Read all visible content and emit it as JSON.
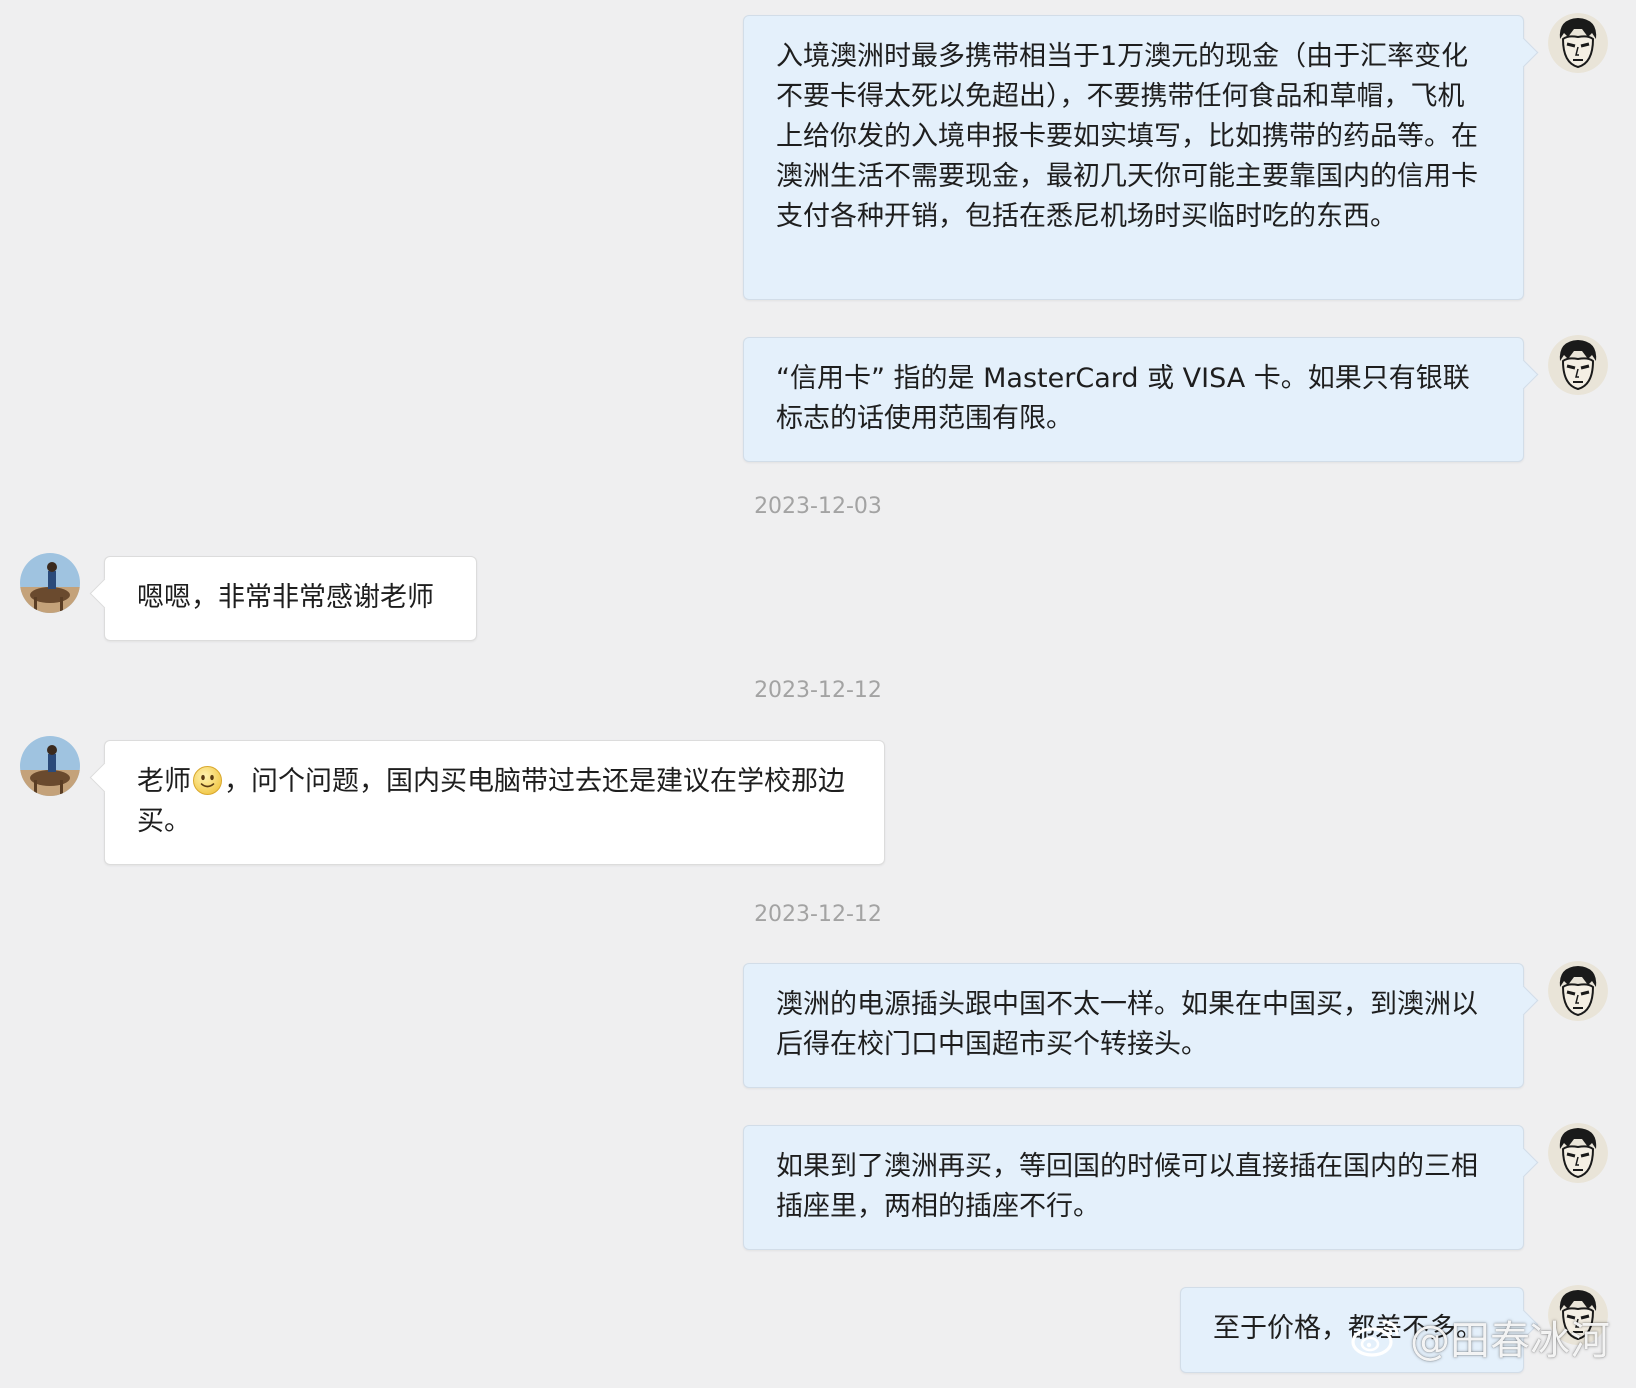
{
  "messages": [
    {
      "sender": "me",
      "text": "入境澳洲时最多携带相当于1万澳元的现金（由于汇率变化不要卡得太死以免超出），不要携带任何食品和草帽，飞机上给你发的入境申报卡要如实填写，比如携带的药品等。在澳洲生活不需要现金，最初几天你可能主要靠国内的信用卡支付各种开销，包括在悉尼机场时买临时吃的东西。"
    },
    {
      "sender": "me",
      "text": "“信用卡” 指的是 MasterCard 或 VISA 卡。如果只有银联标志的话使用范围有限。"
    },
    {
      "sender": "them",
      "text": "嗯嗯，非常非常感谢老师"
    },
    {
      "sender": "them",
      "text_before": "老师",
      "emoji": "smile",
      "text_after": "，问个问题，国内买电脑带过去还是建议在学校那边买。"
    },
    {
      "sender": "me",
      "text": "澳洲的电源插头跟中国不太一样。如果在中国买，到澳洲以后得在校门口中国超市买个转接头。"
    },
    {
      "sender": "me",
      "text": "如果到了澳洲再买，等回国的时候可以直接插在国内的三相插座里，两相的插座不行。"
    },
    {
      "sender": "me",
      "text": "至于价格，都差不多。"
    }
  ],
  "dates": [
    "2023-12-03",
    "2023-12-12",
    "2023-12-12"
  ],
  "watermark": {
    "text": "@田春冰河",
    "icon": "weibo-logo-icon"
  },
  "colors": {
    "background": "#efeff0",
    "my_bubble": "#e4f0fb",
    "their_bubble": "#ffffff",
    "date_text": "#a3a3a3"
  }
}
